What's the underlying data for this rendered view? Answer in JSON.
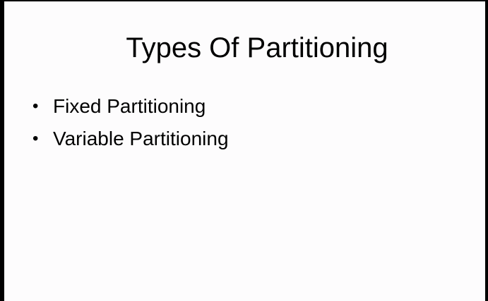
{
  "slide": {
    "title": "Types Of Partitioning",
    "bullets": [
      {
        "marker": "•",
        "text": "Fixed Partitioning"
      },
      {
        "marker": "•",
        "text": "Variable Partitioning"
      }
    ]
  },
  "colors": {
    "background": "#000000",
    "slide": "#fdfcfd",
    "text": "#000000"
  }
}
